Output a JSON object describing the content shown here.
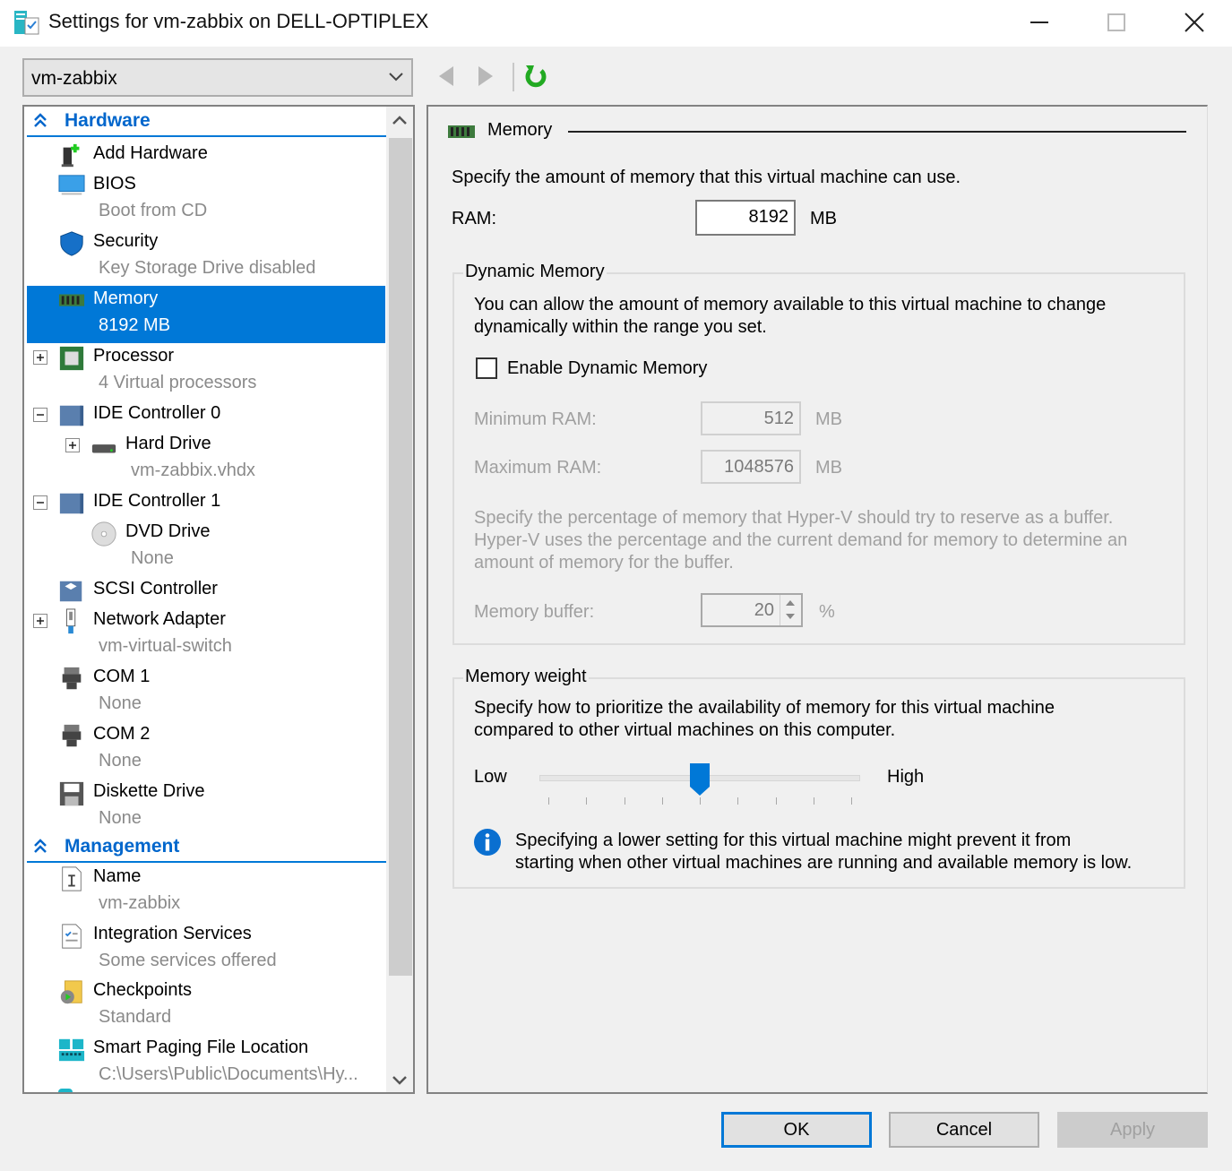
{
  "window": {
    "title": "Settings for vm-zabbix on DELL-OPTIPLEX",
    "icons": {
      "app": "vm-settings-icon",
      "minimize": "minimize-icon",
      "maximize": "maximize-icon",
      "close": "close-icon"
    }
  },
  "vm_selector": {
    "value": "vm-zabbix"
  },
  "nav": {
    "back": "back-arrow-icon",
    "forward": "forward-arrow-icon",
    "refresh": "refresh-icon"
  },
  "tree": {
    "sections": [
      {
        "label": "Hardware",
        "items": [
          {
            "name": "Add Hardware",
            "sub": "",
            "icon": "add-hardware-icon"
          },
          {
            "name": "BIOS",
            "sub": "Boot from CD",
            "icon": "bios-monitor-icon"
          },
          {
            "name": "Security",
            "sub": "Key Storage Drive disabled",
            "icon": "shield-icon"
          },
          {
            "name": "Memory",
            "sub": "8192 MB",
            "icon": "memory-chip-icon",
            "selected": true
          },
          {
            "name": "Processor",
            "sub": "4 Virtual processors",
            "icon": "processor-icon",
            "expander": "+"
          },
          {
            "name": "IDE Controller 0",
            "sub": "",
            "icon": "ide-controller-icon",
            "expander": "-"
          },
          {
            "name": "Hard Drive",
            "sub": "vm-zabbix.vhdx",
            "icon": "hard-drive-icon",
            "expander": "+"
          },
          {
            "name": "IDE Controller 1",
            "sub": "",
            "icon": "ide-controller-icon",
            "expander": "-"
          },
          {
            "name": "DVD Drive",
            "sub": "None",
            "icon": "dvd-drive-icon"
          },
          {
            "name": "SCSI Controller",
            "sub": "",
            "icon": "scsi-controller-icon"
          },
          {
            "name": "Network Adapter",
            "sub": "vm-virtual-switch",
            "icon": "network-adapter-icon",
            "expander": "+"
          },
          {
            "name": "COM 1",
            "sub": "None",
            "icon": "com-port-icon"
          },
          {
            "name": "COM 2",
            "sub": "None",
            "icon": "com-port-icon"
          },
          {
            "name": "Diskette Drive",
            "sub": "None",
            "icon": "floppy-disk-icon"
          }
        ]
      },
      {
        "label": "Management",
        "items": [
          {
            "name": "Name",
            "sub": "vm-zabbix",
            "icon": "name-document-icon"
          },
          {
            "name": "Integration Services",
            "sub": "Some services offered",
            "icon": "integration-services-icon"
          },
          {
            "name": "Checkpoints",
            "sub": "Standard",
            "icon": "checkpoints-icon"
          },
          {
            "name": "Smart Paging File Location",
            "sub": "C:\\Users\\Public\\Documents\\Hy...",
            "icon": "smart-paging-icon"
          }
        ]
      }
    ]
  },
  "memory": {
    "title": "Memory",
    "description": "Specify the amount of memory that this virtual machine can use.",
    "ram_label": "RAM:",
    "ram_value": "8192",
    "ram_unit": "MB",
    "dynamic": {
      "group_label": "Dynamic Memory",
      "description_1": "You can allow the amount of memory available to this virtual machine to change",
      "description_2": "dynamically within the range you set.",
      "enable_label": "Enable Dynamic Memory",
      "enabled": false,
      "min_label": "Minimum RAM:",
      "min_value": "512",
      "min_unit": "MB",
      "max_label": "Maximum RAM:",
      "max_value": "1048576",
      "max_unit": "MB",
      "buffer_desc_1": "Specify the percentage of memory that Hyper-V should try to reserve as a buffer.",
      "buffer_desc_2": "Hyper-V uses the percentage and the current demand for memory to determine an",
      "buffer_desc_3": "amount of memory for the buffer.",
      "buffer_label": "Memory buffer:",
      "buffer_value": "20",
      "buffer_unit": "%"
    },
    "weight": {
      "group_label": "Memory weight",
      "description_1": "Specify how to prioritize the availability of memory for this virtual machine",
      "description_2": "compared to other virtual machines on this computer.",
      "low_label": "Low",
      "high_label": "High",
      "slider_fraction": 0.5,
      "tick_count": 9,
      "info_1": "Specifying a lower setting for this virtual machine might prevent it from",
      "info_2": "starting when other virtual machines are running and available memory is low."
    }
  },
  "buttons": {
    "ok": "OK",
    "cancel": "Cancel",
    "apply": "Apply"
  },
  "colors": {
    "accent": "#0078d7",
    "section_header": "#0066cc",
    "refresh": "#22aa22",
    "disabled_text": "#a0a0a0"
  }
}
